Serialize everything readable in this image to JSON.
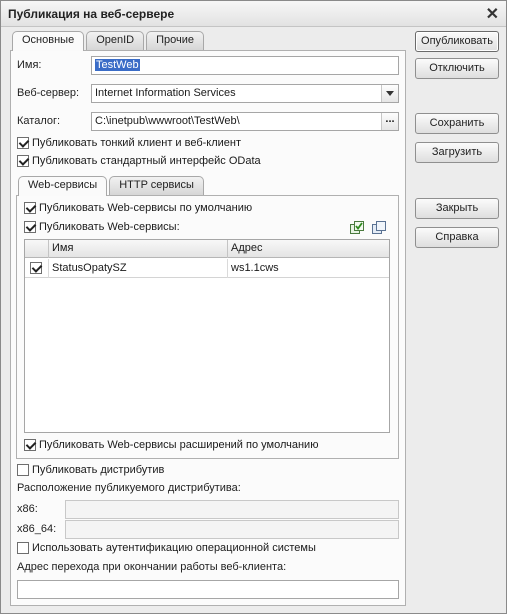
{
  "window": {
    "title": "Публикация на веб-сервере",
    "close_glyph": "✕"
  },
  "tabs": [
    "Основные",
    "OpenID",
    "Прочие"
  ],
  "form": {
    "name_label": "Имя:",
    "name_value": "TestWeb",
    "webserver_label": "Веб-сервер:",
    "webserver_value": "Internet Information Services",
    "catalog_label": "Каталог:",
    "catalog_value": "C:\\inetpub\\wwwroot\\TestWeb\\",
    "catalog_button": "...",
    "publish_thin_client": {
      "label": "Публиковать тонкий клиент и веб-клиент",
      "checked": true
    },
    "publish_odata": {
      "label": "Публиковать стандартный интерфейс OData",
      "checked": true
    }
  },
  "subtabs": [
    "Web-сервисы",
    "HTTP сервисы"
  ],
  "web_services": {
    "publish_default": {
      "label": "Публиковать Web-сервисы по умолчанию",
      "checked": true
    },
    "publish": {
      "label": "Публиковать Web-сервисы:",
      "checked": true
    },
    "check_all_icon": "check-all-icon",
    "uncheck_all_icon": "uncheck-all-icon",
    "columns": [
      "Имя",
      "Адрес"
    ],
    "rows": [
      {
        "checked": true,
        "name": "StatusOpatySZ",
        "address": "ws1.1cws"
      }
    ],
    "publish_extensions": {
      "label": "Публиковать Web-сервисы расширений по умолчанию",
      "checked": true
    }
  },
  "distrib": {
    "publish": {
      "label": "Публиковать дистрибутив",
      "checked": false
    },
    "location_label": "Расположение публикуемого дистрибутива:",
    "x86_label": "x86:",
    "x86_value": "",
    "x86_64_label": "x86_64:",
    "x86_64_value": ""
  },
  "auth": {
    "label": "Использовать аутентификацию операционной системы",
    "checked": false
  },
  "exit_url": {
    "label": "Адрес перехода при окончании работы веб-клиента:",
    "value": ""
  },
  "buttons": {
    "publish": "Опубликовать",
    "unpublish": "Отключить",
    "save": "Сохранить",
    "load": "Загрузить",
    "close": "Закрыть",
    "help": "Справка"
  },
  "colors": {
    "selection": "#3a6cc7",
    "window_bg": "#ececec"
  }
}
